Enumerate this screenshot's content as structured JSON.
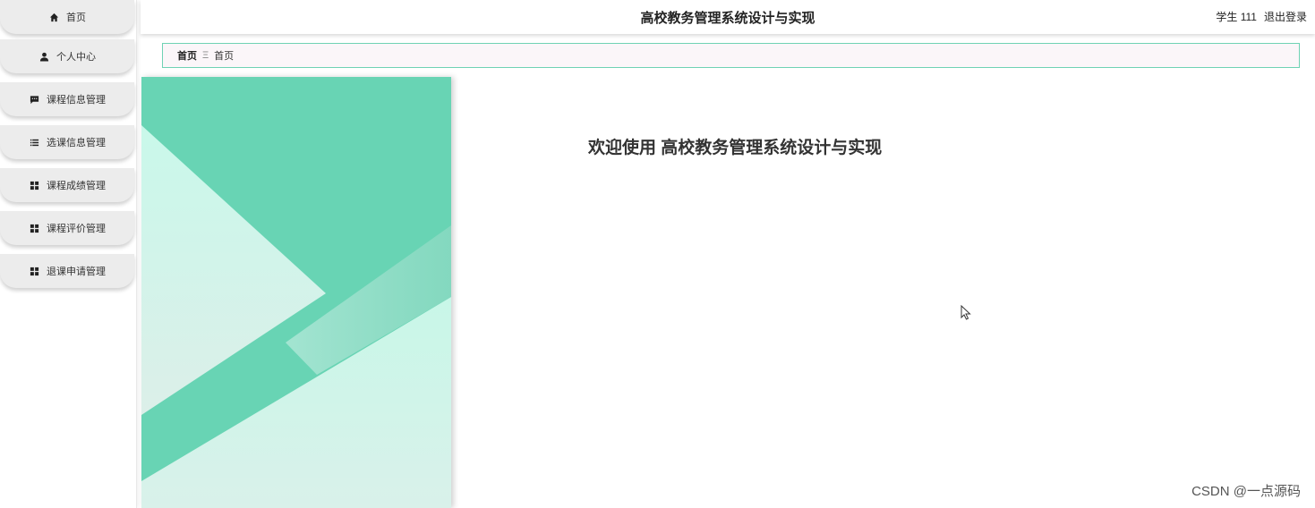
{
  "header": {
    "title": "高校教务管理系统设计与实现",
    "user": "学生 111",
    "logout": "退出登录"
  },
  "sidebar": {
    "items": [
      {
        "label": "首页",
        "icon": "home-icon"
      },
      {
        "label": "个人中心",
        "icon": "user-icon"
      },
      {
        "label": "课程信息管理",
        "icon": "message-icon"
      },
      {
        "label": "选课信息管理",
        "icon": "list-icon"
      },
      {
        "label": "课程成绩管理",
        "icon": "grid-icon"
      },
      {
        "label": "课程评价管理",
        "icon": "grid-icon"
      },
      {
        "label": "退课申请管理",
        "icon": "grid-icon"
      }
    ]
  },
  "breadcrumb": {
    "first": "首页",
    "separator": "Ξ",
    "current": "首页"
  },
  "main": {
    "welcome": "欢迎使用 高校教务管理系统设计与实现"
  },
  "watermark": "CSDN @一点源码",
  "colors": {
    "accent": "#6fd2b4",
    "deco_dark": "#68d4b4",
    "deco_light": "#c9f7e9",
    "menu_bg": "#ececec"
  }
}
